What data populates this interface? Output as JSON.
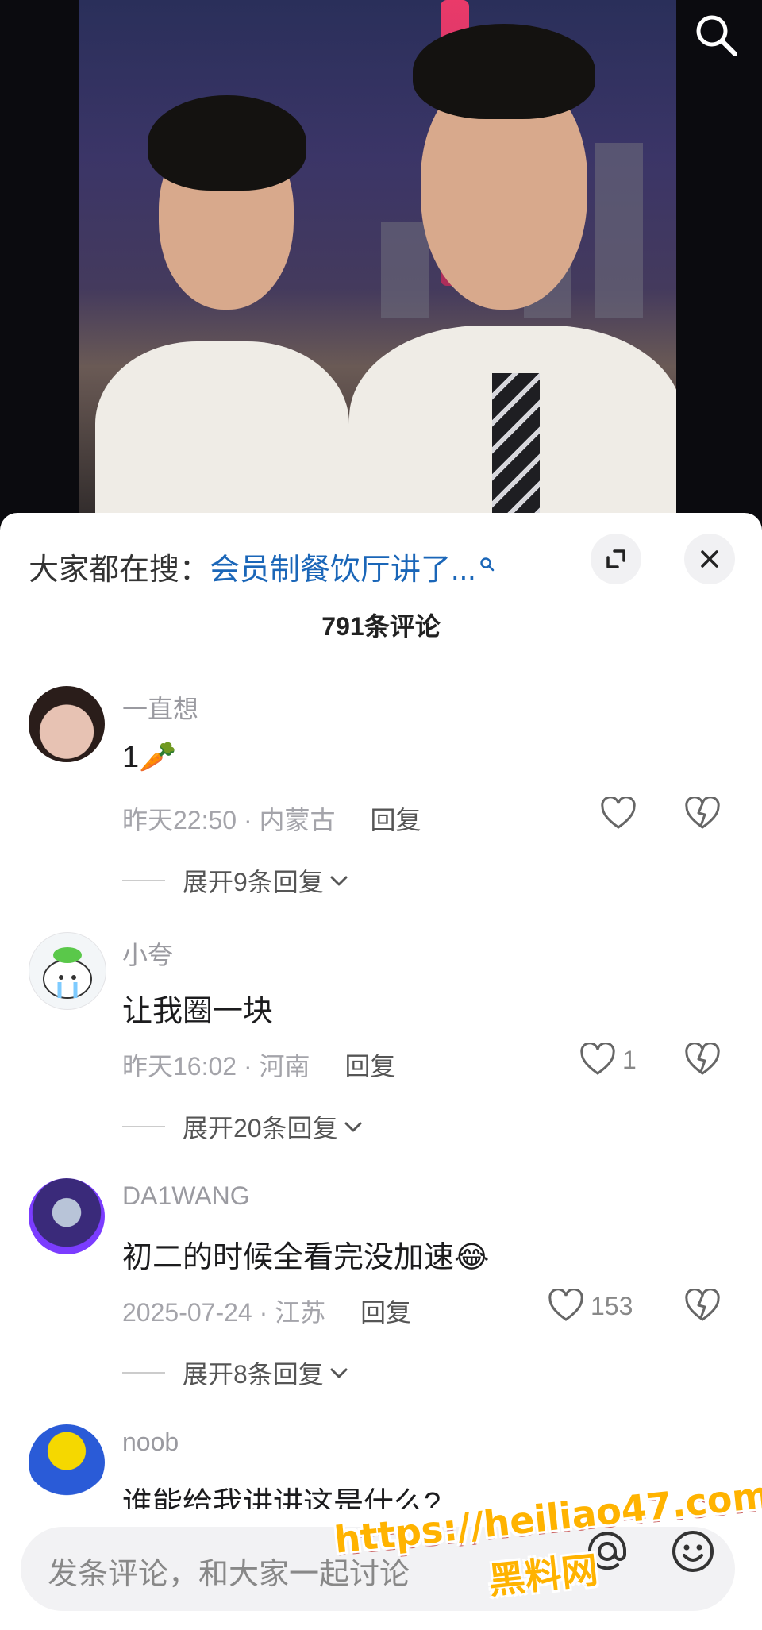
{
  "sheet": {
    "search_prefix": "大家都在搜：",
    "search_keyword": "会员制餐饮厅讲了...",
    "comment_count": "791条评论"
  },
  "comments": [
    {
      "user": "一直想",
      "text": "1🥕",
      "time": "昨天22:50 · 内蒙古",
      "reply": "回复",
      "likes": "",
      "expand": "展开9条回复"
    },
    {
      "user": "小夸",
      "text": "让我圈一块",
      "time": "昨天16:02 · 河南",
      "reply": "回复",
      "likes": "1",
      "expand": "展开20条回复"
    },
    {
      "user": "DA1WANG",
      "text": "初二的时候全看完没加速😂",
      "time": "2025-07-24 · 江苏",
      "reply": "回复",
      "likes": "153",
      "expand": "展开8条回复"
    },
    {
      "user": "noob",
      "text": "谁能给我讲讲这是什么?"
    }
  ],
  "input": {
    "placeholder": "发条评论，和大家一起讨论"
  },
  "watermark": {
    "line1": "https://heiliao47.com",
    "line2": "黑料网"
  },
  "colors": {
    "link": "#1a66b8",
    "sheet_bg": "#ffffff",
    "watermark": "#ffb300"
  }
}
